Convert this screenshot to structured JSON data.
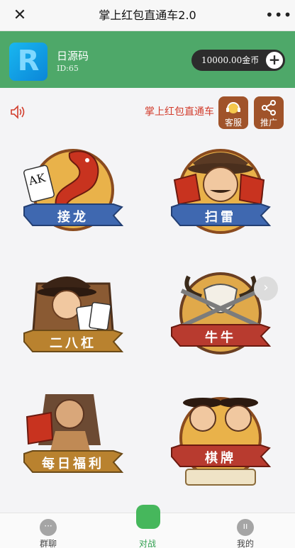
{
  "topbar": {
    "close_icon": "close-icon",
    "title": "掌上红包直通车2.0",
    "more_icon": "more-dots-icon"
  },
  "user": {
    "name": "日源码",
    "id_text": "ID:65",
    "coins_text": "10000.00金币",
    "add_icon": "plus-icon"
  },
  "notice": {
    "speaker_icon": "speaker-icon",
    "text": "掌上红包直通车"
  },
  "side_buttons": [
    {
      "label": "客服",
      "icon": "headset-icon"
    },
    {
      "label": "推广",
      "icon": "share-icon"
    }
  ],
  "games": [
    {
      "label": "接龙",
      "theme": "#3f68b0"
    },
    {
      "label": "扫雷",
      "theme": "#3f68b0"
    },
    {
      "label": "二八杠",
      "theme": "#b9822f"
    },
    {
      "label": "牛牛",
      "theme": "#b83b2f"
    },
    {
      "label": "每日福利",
      "theme": "#b9822f"
    },
    {
      "label": "棋牌",
      "theme": "#b83b2f"
    }
  ],
  "next_icon": "chevron-right-icon",
  "tabs": [
    {
      "label": "群聊",
      "icon": "chat-bubble-icon"
    },
    {
      "label": "对战",
      "icon": "game-controller-icon"
    },
    {
      "label": "我的",
      "icon": "user-icon"
    }
  ],
  "colors": {
    "header_green": "#4ea869",
    "accent_red": "#d23c2c",
    "side_button_brown": "#a0532a"
  }
}
